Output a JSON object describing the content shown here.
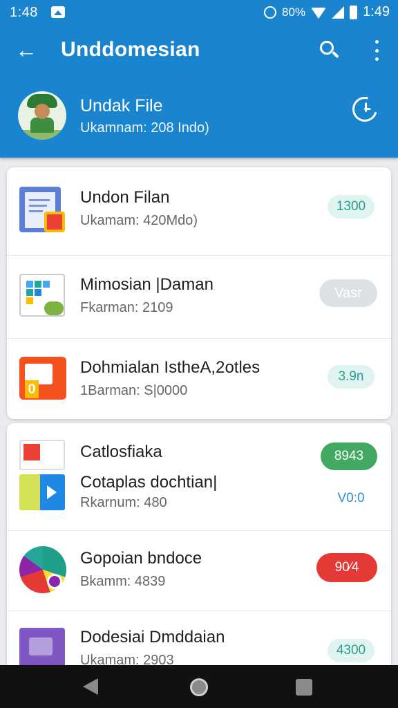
{
  "status_bar": {
    "time_left": "1:48",
    "battery_text": "80%",
    "time_right": "1:49"
  },
  "app_bar": {
    "title": "Unddomesian",
    "profile": {
      "name": "Undak File",
      "subtitle": "Ukamnam: 208 Indo)"
    }
  },
  "list_card_1": [
    {
      "title": "Undon Filan",
      "subtitle": "Ukamam: 420Mdo)",
      "badge": "1300",
      "badge_style": "teal",
      "icon": "document-icon"
    },
    {
      "title": "Mimosian |Daman",
      "subtitle": "Fkarman: 2109",
      "badge": "Vasr",
      "badge_style": "grey",
      "icon": "grid-document-icon"
    },
    {
      "title": "Dohmialan IstheA,2otles",
      "subtitle": "1Barman: S|0000",
      "badge": "3.9n",
      "badge_style": "teal",
      "icon": "slides-icon"
    }
  ],
  "list_card_2": [
    {
      "title": "Catlosfiaka",
      "title2": "Cotaplas dochtian|",
      "subtitle": "Rkarnum: 480",
      "badge": "8943",
      "badge_style": "green",
      "badge2": "V0:0",
      "badge2_style": "plain",
      "icon": "gmail-icon",
      "icon2": "sheet-icon"
    },
    {
      "title": "Gopoian bndoce",
      "subtitle": "Bkamm: 4839",
      "badge": "90⁄4",
      "badge_style": "red",
      "icon": "circle-app-icon"
    },
    {
      "title": "Dodesiai Dmddaian",
      "subtitle": "Ukamam: 2903",
      "badge": "4300",
      "badge_style": "teal",
      "icon": "purple-document-icon"
    }
  ],
  "colors": {
    "app_bar": "#1a84cf",
    "badge_green": "#43a862",
    "badge_red": "#e53935",
    "badge_teal_bg": "#dff3f0"
  }
}
